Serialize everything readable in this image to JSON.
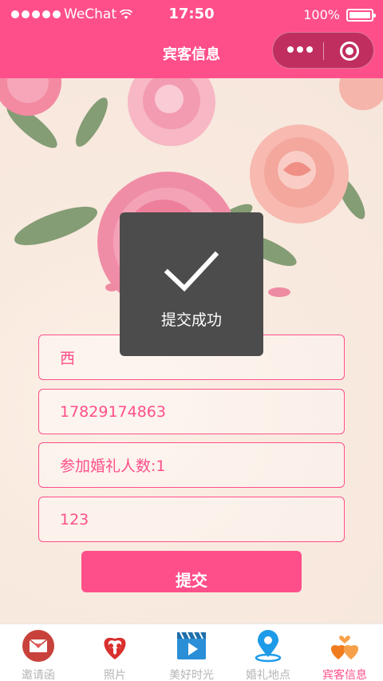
{
  "status_bar": {
    "carrier": "WeChat",
    "time": "17:50",
    "battery": "100%"
  },
  "nav": {
    "title": "宾客信息"
  },
  "form": {
    "name_value": "西",
    "phone_value": "17829174863",
    "guests_value": "参加婚礼人数:1",
    "note_value": "123",
    "submit_label": "提交"
  },
  "toast": {
    "message": "提交成功"
  },
  "tabs": [
    {
      "label": "邀请函",
      "icon": "invitation-icon"
    },
    {
      "label": "照片",
      "icon": "photos-icon"
    },
    {
      "label": "美好时光",
      "icon": "video-icon"
    },
    {
      "label": "婚礼地点",
      "icon": "location-icon"
    },
    {
      "label": "宾客信息",
      "icon": "guest-info-icon",
      "active": true
    }
  ],
  "colors": {
    "accent": "#ff4f8b",
    "toast_bg": "#4c4c4c"
  }
}
